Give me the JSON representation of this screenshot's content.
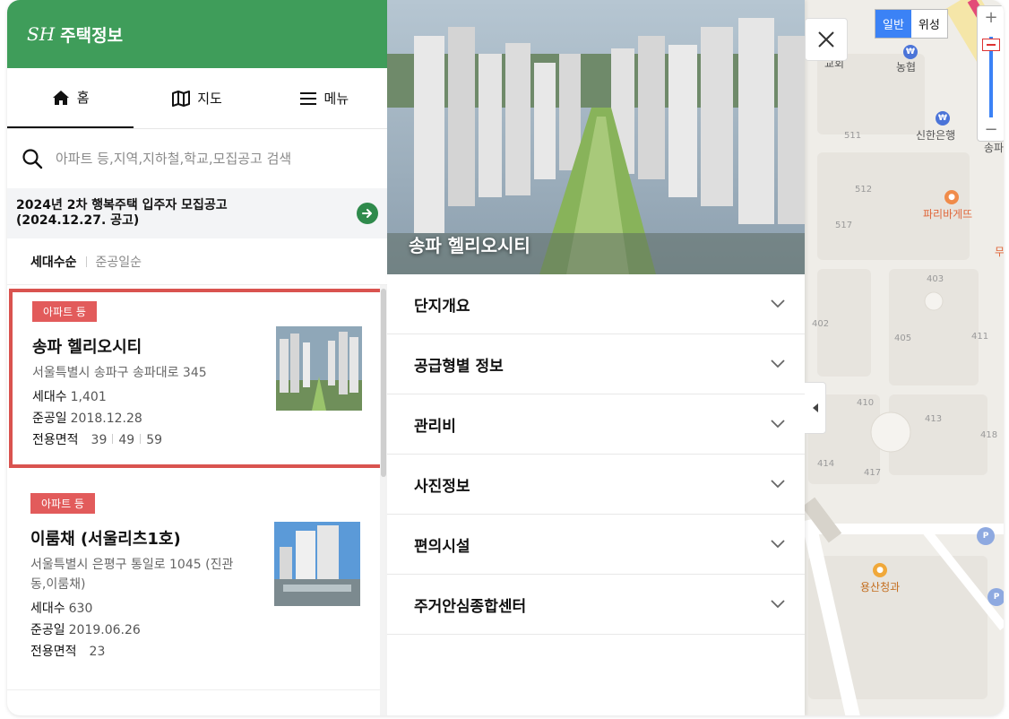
{
  "brand": {
    "logo": "SH",
    "name": "주택정보"
  },
  "nav": [
    {
      "label": "홈",
      "icon": "home-icon",
      "active": true
    },
    {
      "label": "지도",
      "icon": "map-icon",
      "active": false
    },
    {
      "label": "메뉴",
      "icon": "hamburger-icon",
      "active": false
    }
  ],
  "search": {
    "placeholder": "아파트 등,지역,지하철,학교,모집공고 검색"
  },
  "notice": {
    "line1": "2024년 2차 행복주택 입주자 모집공고",
    "line2": "(2024.12.27. 공고)"
  },
  "sort": {
    "active": "세대수순",
    "inactive": "준공일순"
  },
  "listings": [
    {
      "badge": "아파트 등",
      "title": "송파 헬리오시티",
      "address": "서울특별시 송파구 송파대로 345",
      "units_label": "세대수",
      "units": "1,401",
      "date_label": "준공일",
      "date": "2018.12.28",
      "area_label": "전용면적",
      "areas": [
        "39",
        "49",
        "59"
      ]
    },
    {
      "badge": "아파트 등",
      "title": "이룸채 (서울리츠1호)",
      "address": "서울특별시 은평구 통일로 1045 (진관동,이룸채)",
      "units_label": "세대수",
      "units": "630",
      "date_label": "준공일",
      "date": "2019.06.26",
      "area_label": "전용면적",
      "areas": [
        "23"
      ]
    }
  ],
  "detail": {
    "title": "송파 헬리오시티",
    "sections": [
      "단지개요",
      "공급형별 정보",
      "관리비",
      "사진정보",
      "편의시설",
      "주거안심종합센터"
    ]
  },
  "map": {
    "types": [
      "일반",
      "위성"
    ],
    "labels": {
      "church": "교회",
      "nonghyup": "농협",
      "shinhan": "신한은행",
      "paris": "파리바게뜨",
      "yongsan": "용산청과",
      "songpa": "송파",
      "mu": "무"
    },
    "block_numbers": [
      "511",
      "512",
      "517",
      "403",
      "402",
      "405",
      "411",
      "410",
      "413",
      "418",
      "414",
      "417"
    ]
  },
  "colors": {
    "brand_green": "#3f9d5a",
    "highlight_red": "#d9534f",
    "badge_red": "#e25b5b",
    "map_blue": "#3b82f6"
  }
}
